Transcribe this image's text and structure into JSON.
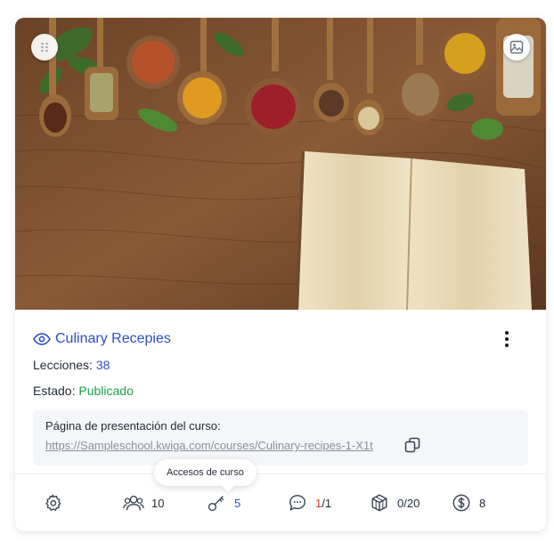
{
  "course": {
    "title": "Culinary Recepies",
    "lessons_label": "Lecciones:",
    "lessons_value": "38",
    "status_label": "Estado:",
    "status_value": "Publicado"
  },
  "presentation": {
    "label": "Página de presentación del curso:",
    "url": "https://Sampleschool.kwiga.com/courses/Culinary-recipes-1-X1t"
  },
  "tooltip": {
    "text": "Accesos de curso"
  },
  "stats": {
    "students": "10",
    "accesses": "5",
    "comments_unread": "1",
    "comments_sep_total": "/1",
    "modules": "0/20",
    "sales": "8"
  },
  "icons": [
    "drag-icon",
    "image-icon",
    "eye-icon",
    "more-vertical-icon",
    "copy-icon",
    "gear-icon",
    "users-icon",
    "key-icon",
    "comment-icon",
    "cube-icon",
    "dollar-icon"
  ],
  "colors": {
    "accent": "#2c4ec7",
    "published": "#16a34a",
    "unread": "#e23b3b"
  }
}
